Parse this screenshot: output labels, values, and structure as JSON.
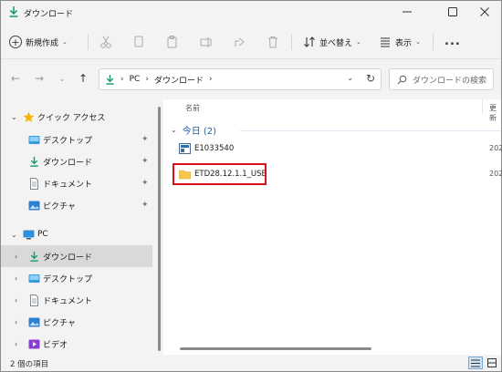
{
  "window": {
    "title": "ダウンロード"
  },
  "toolbar": {
    "new_label": "新規作成",
    "sort_label": "並べ替え",
    "view_label": "表示",
    "more_label": "..."
  },
  "address": {
    "crumbs": [
      "PC",
      "ダウンロード"
    ],
    "search_placeholder": "ダウンロードの検索"
  },
  "sidebar": {
    "quick_access": "クイック アクセス",
    "quick_items": [
      "デスクトップ",
      "ダウンロード",
      "ドキュメント",
      "ピクチャ"
    ],
    "pc_label": "PC",
    "pc_items": [
      "ダウンロード",
      "デスクトップ",
      "ドキュメント",
      "ピクチャ",
      "ビデオ"
    ]
  },
  "content": {
    "col_name": "名前",
    "col_date": "更新",
    "group_label": "今日 (2)",
    "files": [
      {
        "name": "E1033540",
        "date": "202"
      },
      {
        "name": "ETD28.12.1.1_USB",
        "date": "202"
      }
    ]
  },
  "status": {
    "text": "2 個の項目"
  },
  "colors": {
    "accent": "#1d5ea8",
    "highlight": "#d8101c",
    "folder": "#f7c64a",
    "download": "#1e9e6a"
  }
}
